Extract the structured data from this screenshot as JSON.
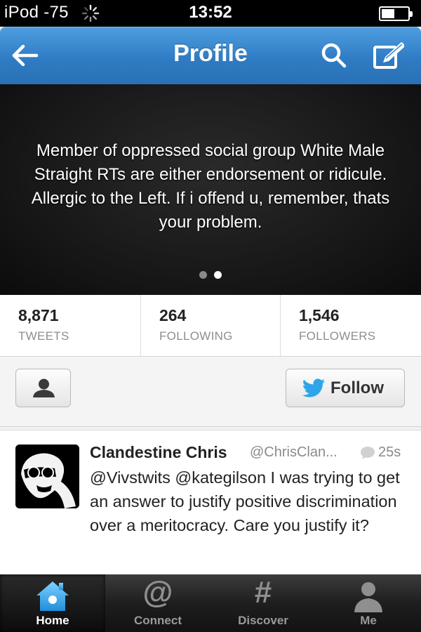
{
  "status_bar": {
    "carrier": "iPod -75",
    "time": "13:52"
  },
  "nav": {
    "title": "Profile"
  },
  "bio": {
    "text": "Member of oppressed social group White Male Straight RTs are either endorsement or ridicule. Allergic to the Left. If i offend u, remember, thats your problem.",
    "page_count": 2,
    "active_page": 2
  },
  "stats": [
    {
      "value": "8,871",
      "label": "TWEETS"
    },
    {
      "value": "264",
      "label": "FOLLOWING"
    },
    {
      "value": "1,546",
      "label": "FOLLOWERS"
    }
  ],
  "actions": {
    "follow_label": "Follow"
  },
  "tweet": {
    "name": "Clandestine Chris",
    "handle": "@ChrisClan...",
    "time": "25s",
    "text": "@Vivstwits @kategilson I was trying to get an answer to justify positive discrimination over a meritocracy. Care you justify it?"
  },
  "tabs": [
    {
      "label": "Home",
      "icon": "house-icon",
      "active": true
    },
    {
      "label": "Connect",
      "icon": "at-sign-icon",
      "glyph": "@",
      "active": false
    },
    {
      "label": "Discover",
      "icon": "hashtag-icon",
      "glyph": "#",
      "active": false
    },
    {
      "label": "Me",
      "icon": "person-icon",
      "active": false
    }
  ],
  "colors": {
    "nav_blue": "#3a8bd4",
    "twitter_blue": "#2ea5e8",
    "tab_bar": "#1e1e1e"
  }
}
